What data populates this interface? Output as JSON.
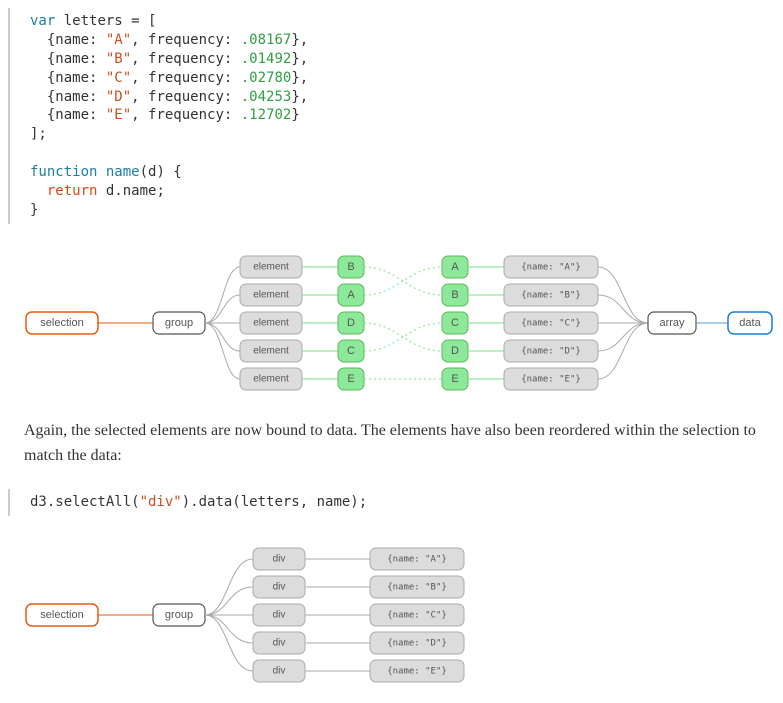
{
  "code1": {
    "kw_var": "var",
    "decl_name": "letters",
    "op_eq": " = [",
    "rows": [
      {
        "open": "  {name:",
        "str": " \"A\"",
        "mid": ", frequency:",
        "num": " .08167",
        "close": "},"
      },
      {
        "open": "  {name:",
        "str": " \"B\"",
        "mid": ", frequency:",
        "num": " .01492",
        "close": "},"
      },
      {
        "open": "  {name:",
        "str": " \"C\"",
        "mid": ", frequency:",
        "num": " .02780",
        "close": "},"
      },
      {
        "open": "  {name:",
        "str": " \"D\"",
        "mid": ", frequency:",
        "num": " .04253",
        "close": "},"
      },
      {
        "open": "  {name:",
        "str": " \"E\"",
        "mid": ", frequency:",
        "num": " .12702",
        "close": "}"
      }
    ],
    "close_arr": "];",
    "kw_function": "function",
    "fn_name": " name",
    "fn_params": "(d) {",
    "kw_return": "  return",
    "ret_body": " d.name;",
    "fn_close": "}"
  },
  "diagram1": {
    "selection": "selection",
    "group": "group",
    "elements": [
      "element",
      "element",
      "element",
      "element",
      "element"
    ],
    "left_letters": [
      "B",
      "A",
      "D",
      "C",
      "E"
    ],
    "right_letters": [
      "A",
      "B",
      "C",
      "D",
      "E"
    ],
    "data_objs": [
      "{name: \"A\"}",
      "{name: \"B\"}",
      "{name: \"C\"}",
      "{name: \"D\"}",
      "{name: \"E\"}"
    ],
    "array": "array",
    "data": "data"
  },
  "prose1": "Again, the selected elements are now bound to data. The elements have also been reordered within the selection to match the data:",
  "code2": {
    "line": "d3.selectAll(\"div\").data(letters, name);",
    "prefix": "d3.selectAll(",
    "str": "\"div\"",
    "suffix": ").data(letters, name);"
  },
  "diagram2": {
    "selection": "selection",
    "group": "group",
    "divs": [
      "div",
      "div",
      "div",
      "div",
      "div"
    ],
    "data_objs": [
      "{name: \"A\"}",
      "{name: \"B\"}",
      "{name: \"C\"}",
      "{name: \"D\"}",
      "{name: \"E\"}"
    ]
  }
}
